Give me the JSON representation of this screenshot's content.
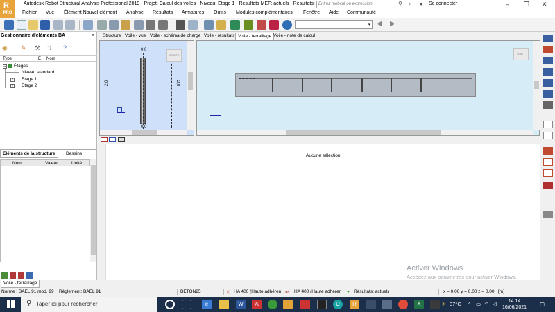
{
  "app": {
    "logo_label": "PRO",
    "title": "Autodesk Robot Structural Analysis Professional 2019 - Projet: Calcul des voiles - Niveau: Etage 1 - Résultats MEF: actuels - Résultats: ...",
    "search_placeholder": "Entrez mot-clé ou expression",
    "connect_label": "Se connecter"
  },
  "menu": [
    "Fichier",
    "Vue",
    "Élément Nouvel élément",
    "Analyse",
    "Résultats",
    "Armatures",
    "Outils",
    "Modules complémentaires",
    "Fenêtre",
    "Aide",
    "Communauté"
  ],
  "left_panel": {
    "title": "Gestionnaire d'éléments BA",
    "columns": [
      "Type",
      "E",
      "Nom"
    ],
    "tree": {
      "root": "Étages",
      "children": [
        "Niveau standard",
        "Etage 1",
        "Etage 2"
      ]
    },
    "tabs": [
      "Eléments de la structure",
      "Dessins"
    ],
    "props_columns": [
      "Nom",
      "Valeur",
      "Unité"
    ]
  },
  "view_tabs": [
    "Structure",
    "Voile - vue",
    "Voile - schéma de charge",
    "Voile - résultats",
    "Voile - ferraillage",
    "Voile - note de calcul"
  ],
  "active_view_tab": "Voile - ferraillage",
  "left_view": {
    "top_label": "0,0",
    "side_label_left": "2,0",
    "side_label_right": "2,0",
    "bottom_label": "0,0"
  },
  "lower_panel": {
    "message": "Aucune sélection"
  },
  "watermark": {
    "title": "Activer Windows",
    "subtitle": "Accédez aux paramètres pour activer Windows."
  },
  "bottom_tab": "Voile - ferraillage",
  "status": {
    "norme": "Norme : BAEL 91 mod. 99",
    "reglement": "Règlement: BAEL 91",
    "beton": "BETON25",
    "acier1": "HA 400 (Haute adhéren",
    "acier2": "HA 400 (Haute adhéren",
    "resultats": "Résultats: actuels",
    "coords": "x = 0,00 y = 0,00 z = 0,00",
    "unit": "[m]"
  },
  "taskbar": {
    "search_placeholder": "Taper ici pour rechercher",
    "temperature": "37°C",
    "time": "14:14",
    "date": "16/06/2021"
  },
  "colors": {
    "taskbar": "#1b2f4a",
    "viewport_left": "#cfe0fb",
    "viewport_right": "#d6ecf7",
    "logo": "#e8a33a"
  }
}
